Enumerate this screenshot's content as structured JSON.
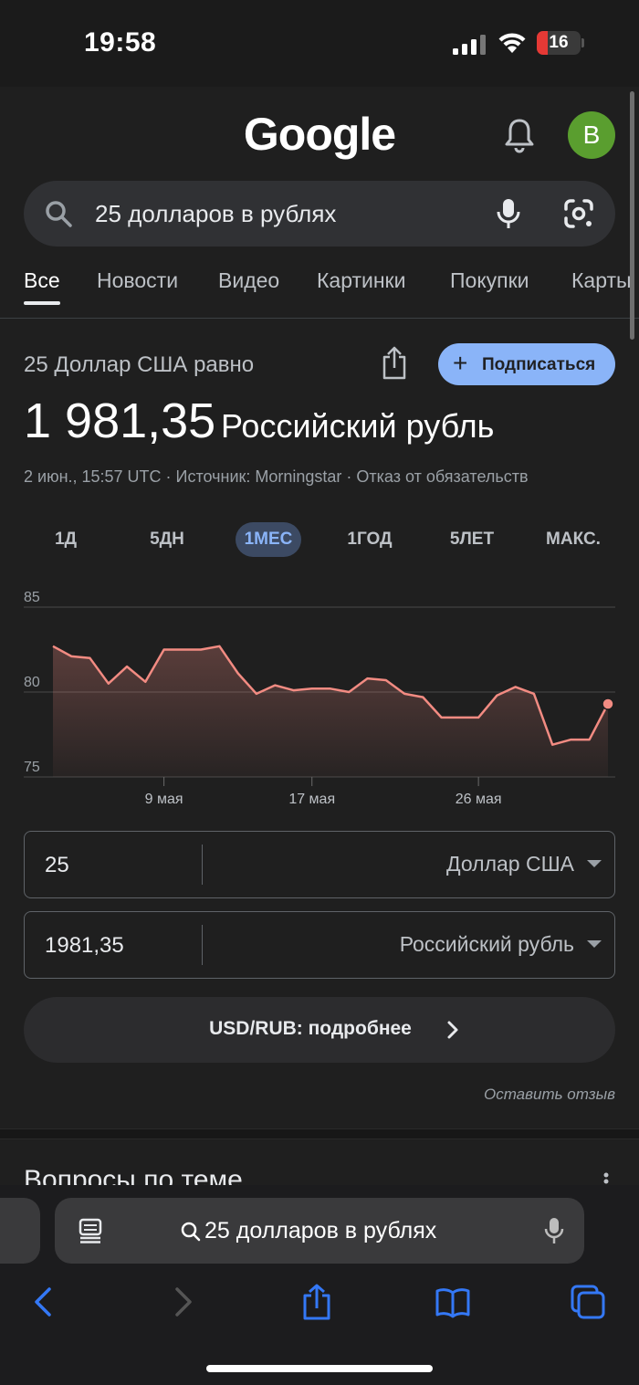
{
  "status_bar": {
    "time": "19:58",
    "battery": "16"
  },
  "header": {
    "logo": "Google",
    "avatar_letter": "В"
  },
  "search": {
    "query": "25 долларов в рублях"
  },
  "tabs": [
    "Все",
    "Новости",
    "Видео",
    "Картинки",
    "Покупки",
    "Карты"
  ],
  "converter": {
    "equals_label": "25 Доллар США равно",
    "subscribe_label": "Подписаться",
    "result_value": "1 981,35",
    "result_unit": "Российский рубль",
    "meta": "2 июн., 15:57 UTC · Источник: Morningstar · Отказ от обязательств",
    "periods": [
      "1Д",
      "5ДН",
      "1МЕС",
      "1ГОД",
      "5ЛЕТ",
      "МАКС."
    ],
    "active_period": "1МЕС",
    "from": {
      "value": "25",
      "currency": "Доллар США"
    },
    "to": {
      "value": "1981,35",
      "currency": "Российский рубль"
    },
    "more_label": "USD/RUB: подробнее",
    "feedback": "Оставить отзыв"
  },
  "related": {
    "title": "Вопросы по теме"
  },
  "safari": {
    "url_text": "25 долларов в рублях"
  },
  "colors": {
    "accent": "#8ab4f8",
    "line": "#f28b82",
    "avatar": "#5a9e2f"
  },
  "chart_data": {
    "type": "area",
    "y_ticks": [
      "85",
      "80",
      "75"
    ],
    "ylim": [
      75,
      85
    ],
    "x_ticks": [
      "9 мая",
      "17 мая",
      "26 мая"
    ],
    "x_tick_index": [
      6,
      14,
      23
    ],
    "values": [
      82.7,
      82.1,
      82.0,
      80.5,
      81.5,
      80.6,
      82.5,
      82.5,
      82.5,
      82.7,
      81.1,
      79.9,
      80.4,
      80.1,
      80.2,
      80.2,
      80.0,
      80.8,
      80.7,
      79.9,
      79.7,
      78.5,
      78.5,
      78.5,
      79.8,
      80.3,
      79.9,
      76.9,
      77.2,
      77.2,
      79.3
    ],
    "grid": true
  }
}
